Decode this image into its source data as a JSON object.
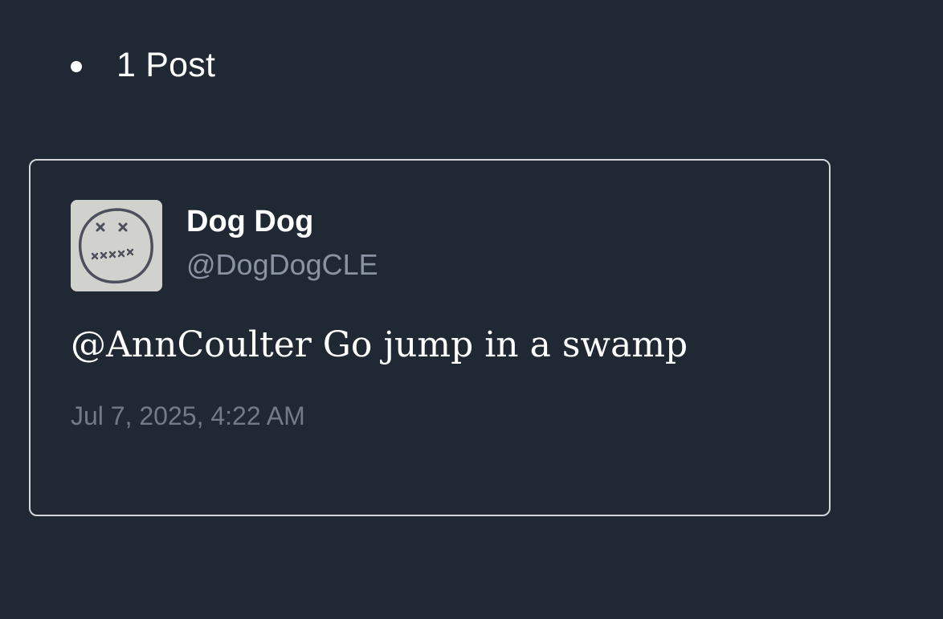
{
  "post_count": {
    "label": "1 Post"
  },
  "post": {
    "author": {
      "name": "Dog Dog",
      "handle": "@DogDogCLE",
      "avatar_icon": "sketch-face-avatar"
    },
    "text": "@AnnCoulter Go jump in a swamp",
    "timestamp": "Jul 7, 2025, 4:22 AM"
  },
  "colors": {
    "background": "#202834",
    "card_border": "#d4d6d9",
    "name_text": "#ffffff",
    "handle_text": "#8993a1",
    "timestamp_text": "#747b86"
  }
}
